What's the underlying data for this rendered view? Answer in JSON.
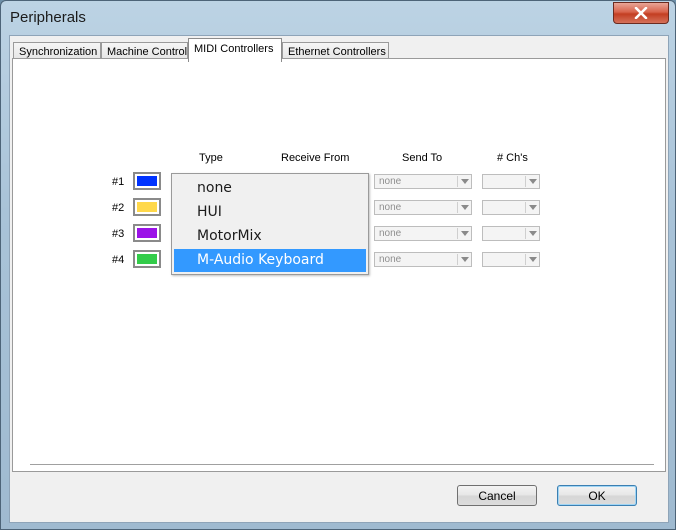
{
  "window": {
    "title": "Peripherals"
  },
  "tabs": [
    {
      "label": "Synchronization",
      "active": false
    },
    {
      "label": "Machine Control",
      "active": false
    },
    {
      "label": "MIDI Controllers",
      "active": true
    },
    {
      "label": "Ethernet Controllers",
      "active": false
    }
  ],
  "columns": {
    "type": "Type",
    "receive_from": "Receive From",
    "send_to": "Send To",
    "channels": "# Ch's"
  },
  "rows": [
    {
      "number": "#1",
      "color": "#0033ff",
      "send_to": "none",
      "channels": ""
    },
    {
      "number": "#2",
      "color": "#ffd84a",
      "send_to": "none",
      "channels": ""
    },
    {
      "number": "#3",
      "color": "#9b12e8",
      "send_to": "none",
      "channels": ""
    },
    {
      "number": "#4",
      "color": "#33cc4a",
      "send_to": "none",
      "channels": ""
    }
  ],
  "type_dropdown": {
    "options": [
      "none",
      "HUI",
      "MotorMix",
      "M-Audio Keyboard"
    ],
    "highlighted": "M-Audio Keyboard"
  },
  "buttons": {
    "cancel": "Cancel",
    "ok": "OK"
  },
  "colors": {
    "selection": "#3399ff",
    "close_button": "#c33e22"
  }
}
